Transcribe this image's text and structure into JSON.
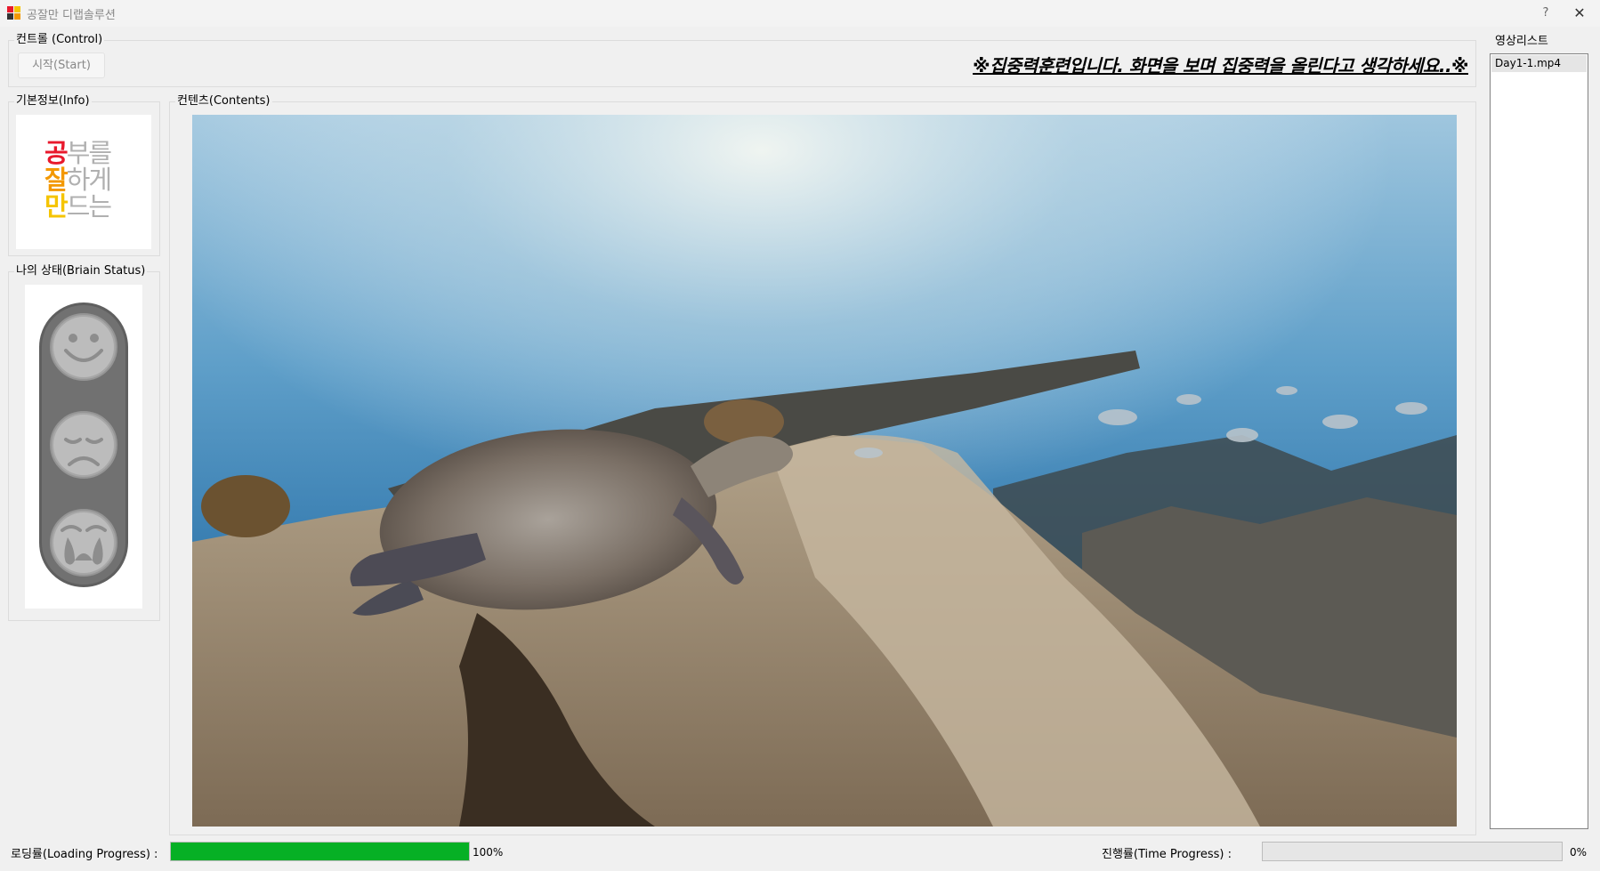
{
  "window": {
    "title": "공잘만 디랩솔루션",
    "help_label": "?",
    "close_label": "✕"
  },
  "control": {
    "group_label": "컨트롤 (Control)",
    "start_label": "시작(Start)",
    "notice": "※집중력훈련입니다. 화면을 보며 집중력을 올린다고 생각하세요..※"
  },
  "info": {
    "group_label": "기본정보(Info)",
    "logo_rows": [
      [
        "공",
        "부",
        "를"
      ],
      [
        "잘",
        "하",
        "게"
      ],
      [
        "만",
        "드",
        "는"
      ]
    ],
    "logo_colors": {
      "row1": "#e8192c",
      "row2": "#f39800",
      "row3": "#f5c400",
      "light": "#b0b0b0"
    }
  },
  "status": {
    "group_label": "나의 상태(Briain Status)",
    "faces": [
      "smile-face-icon",
      "sad-face-icon",
      "crying-face-icon"
    ]
  },
  "contents": {
    "group_label": "컨텐츠(Contents)"
  },
  "playlist": {
    "group_label": "영상리스트",
    "items": [
      "Day1-1.mp4"
    ]
  },
  "progress": {
    "loading_label": "로딩률(Loading Progress) :",
    "loading_value": 100,
    "loading_text": "100%",
    "time_label": "진행률(Time Progress) :",
    "time_value": 0,
    "time_text": "0%",
    "fill_color": "#06b025"
  }
}
